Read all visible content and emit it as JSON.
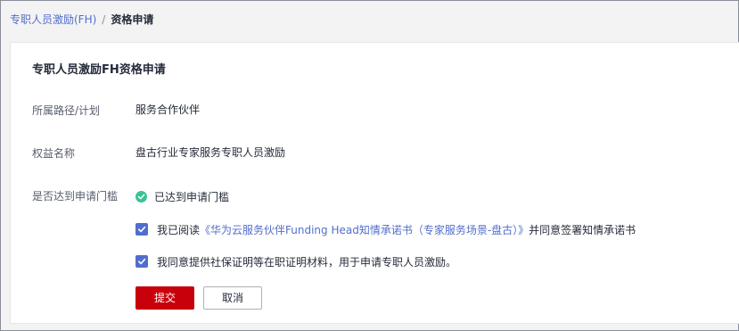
{
  "breadcrumb": {
    "parent": "专职人员激励(FH)",
    "separator": "/",
    "current": "资格申请"
  },
  "card": {
    "title": "专职人员激励FH资格申请",
    "path_label": "所属路径/计划",
    "path_value": "服务合作伙伴",
    "benefit_label": "权益名称",
    "benefit_value": "盘古行业专家服务专职人员激励",
    "threshold_label": "是否达到申请门槛",
    "threshold_status": "已达到申请门槛"
  },
  "agreements": {
    "first_prefix": "我已阅读",
    "first_link": "《华为云服务伙伴Funding Head知情承诺书（专家服务场景-盘古）》",
    "first_suffix": "并同意签署知情承诺书",
    "first_checked": true,
    "second_text": "我同意提供社保证明等在职证明材料，用于申请专职人员激励。",
    "second_checked": true
  },
  "actions": {
    "submit_label": "提交",
    "cancel_label": "取消"
  },
  "colors": {
    "accent": "#526ecc",
    "primary_button": "#c7000b",
    "success": "#3ac295"
  }
}
